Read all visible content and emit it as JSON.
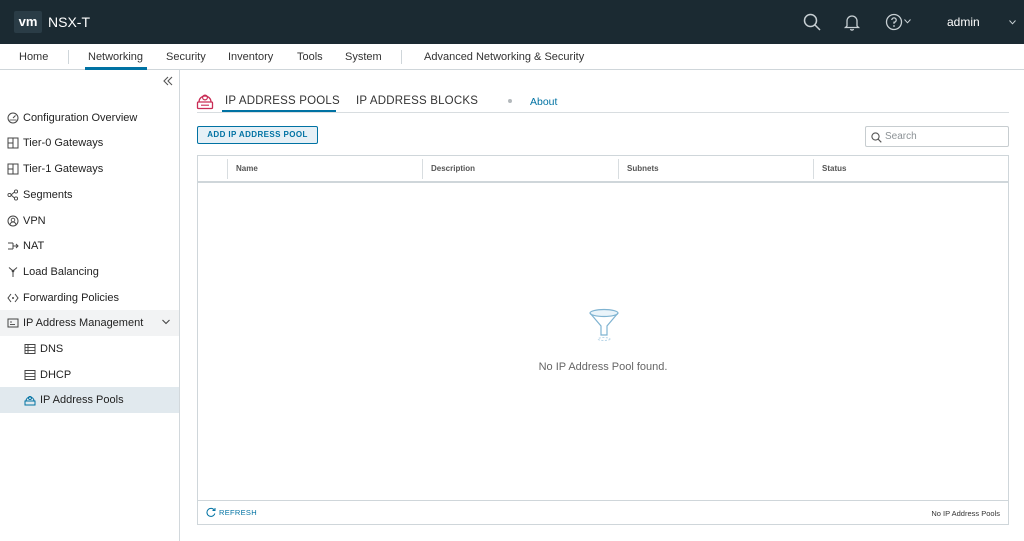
{
  "app": {
    "logo": "vm",
    "product": "NSX-T",
    "user": "admin"
  },
  "top_icons": [
    "search-icon",
    "bell-icon",
    "help-icon"
  ],
  "nav": {
    "items": [
      "Home",
      "Networking",
      "Security",
      "Inventory",
      "Tools",
      "System",
      "Advanced Networking & Security"
    ],
    "active": "Networking"
  },
  "sidebar": {
    "items": [
      {
        "label": "Configuration Overview",
        "icon": "dashboard-icon"
      },
      {
        "label": "Tier-0 Gateways",
        "icon": "gateway-icon"
      },
      {
        "label": "Tier-1 Gateways",
        "icon": "gateway-icon"
      },
      {
        "label": "Segments",
        "icon": "segments-icon"
      },
      {
        "label": "VPN",
        "icon": "vpn-icon"
      },
      {
        "label": "NAT",
        "icon": "nat-icon"
      },
      {
        "label": "Load Balancing",
        "icon": "load-balancer-icon"
      },
      {
        "label": "Forwarding Policies",
        "icon": "forwarding-icon"
      },
      {
        "label": "IP Address Management",
        "icon": "ipam-icon"
      }
    ],
    "subitems": [
      {
        "label": "DNS",
        "icon": "dns-icon"
      },
      {
        "label": "DHCP",
        "icon": "dhcp-icon"
      },
      {
        "label": "IP Address Pools",
        "icon": "ip-pool-icon"
      }
    ],
    "active": "IP Address Pools"
  },
  "tabs": {
    "items": [
      "IP ADDRESS POOLS",
      "IP ADDRESS BLOCKS"
    ],
    "active": "IP ADDRESS POOLS",
    "about": "About"
  },
  "toolbar": {
    "add_label": "ADD IP ADDRESS POOL",
    "search_placeholder": "Search"
  },
  "table": {
    "columns": [
      "Name",
      "Description",
      "Subnets",
      "Status"
    ],
    "rows": [],
    "empty_message": "No IP Address Pool found.",
    "refresh_label": "REFRESH",
    "footer_count": "No IP Address Pools"
  },
  "colors": {
    "topbar": "#1b2a32",
    "accent": "#0072a3",
    "tab_icon": "#c92c55"
  }
}
